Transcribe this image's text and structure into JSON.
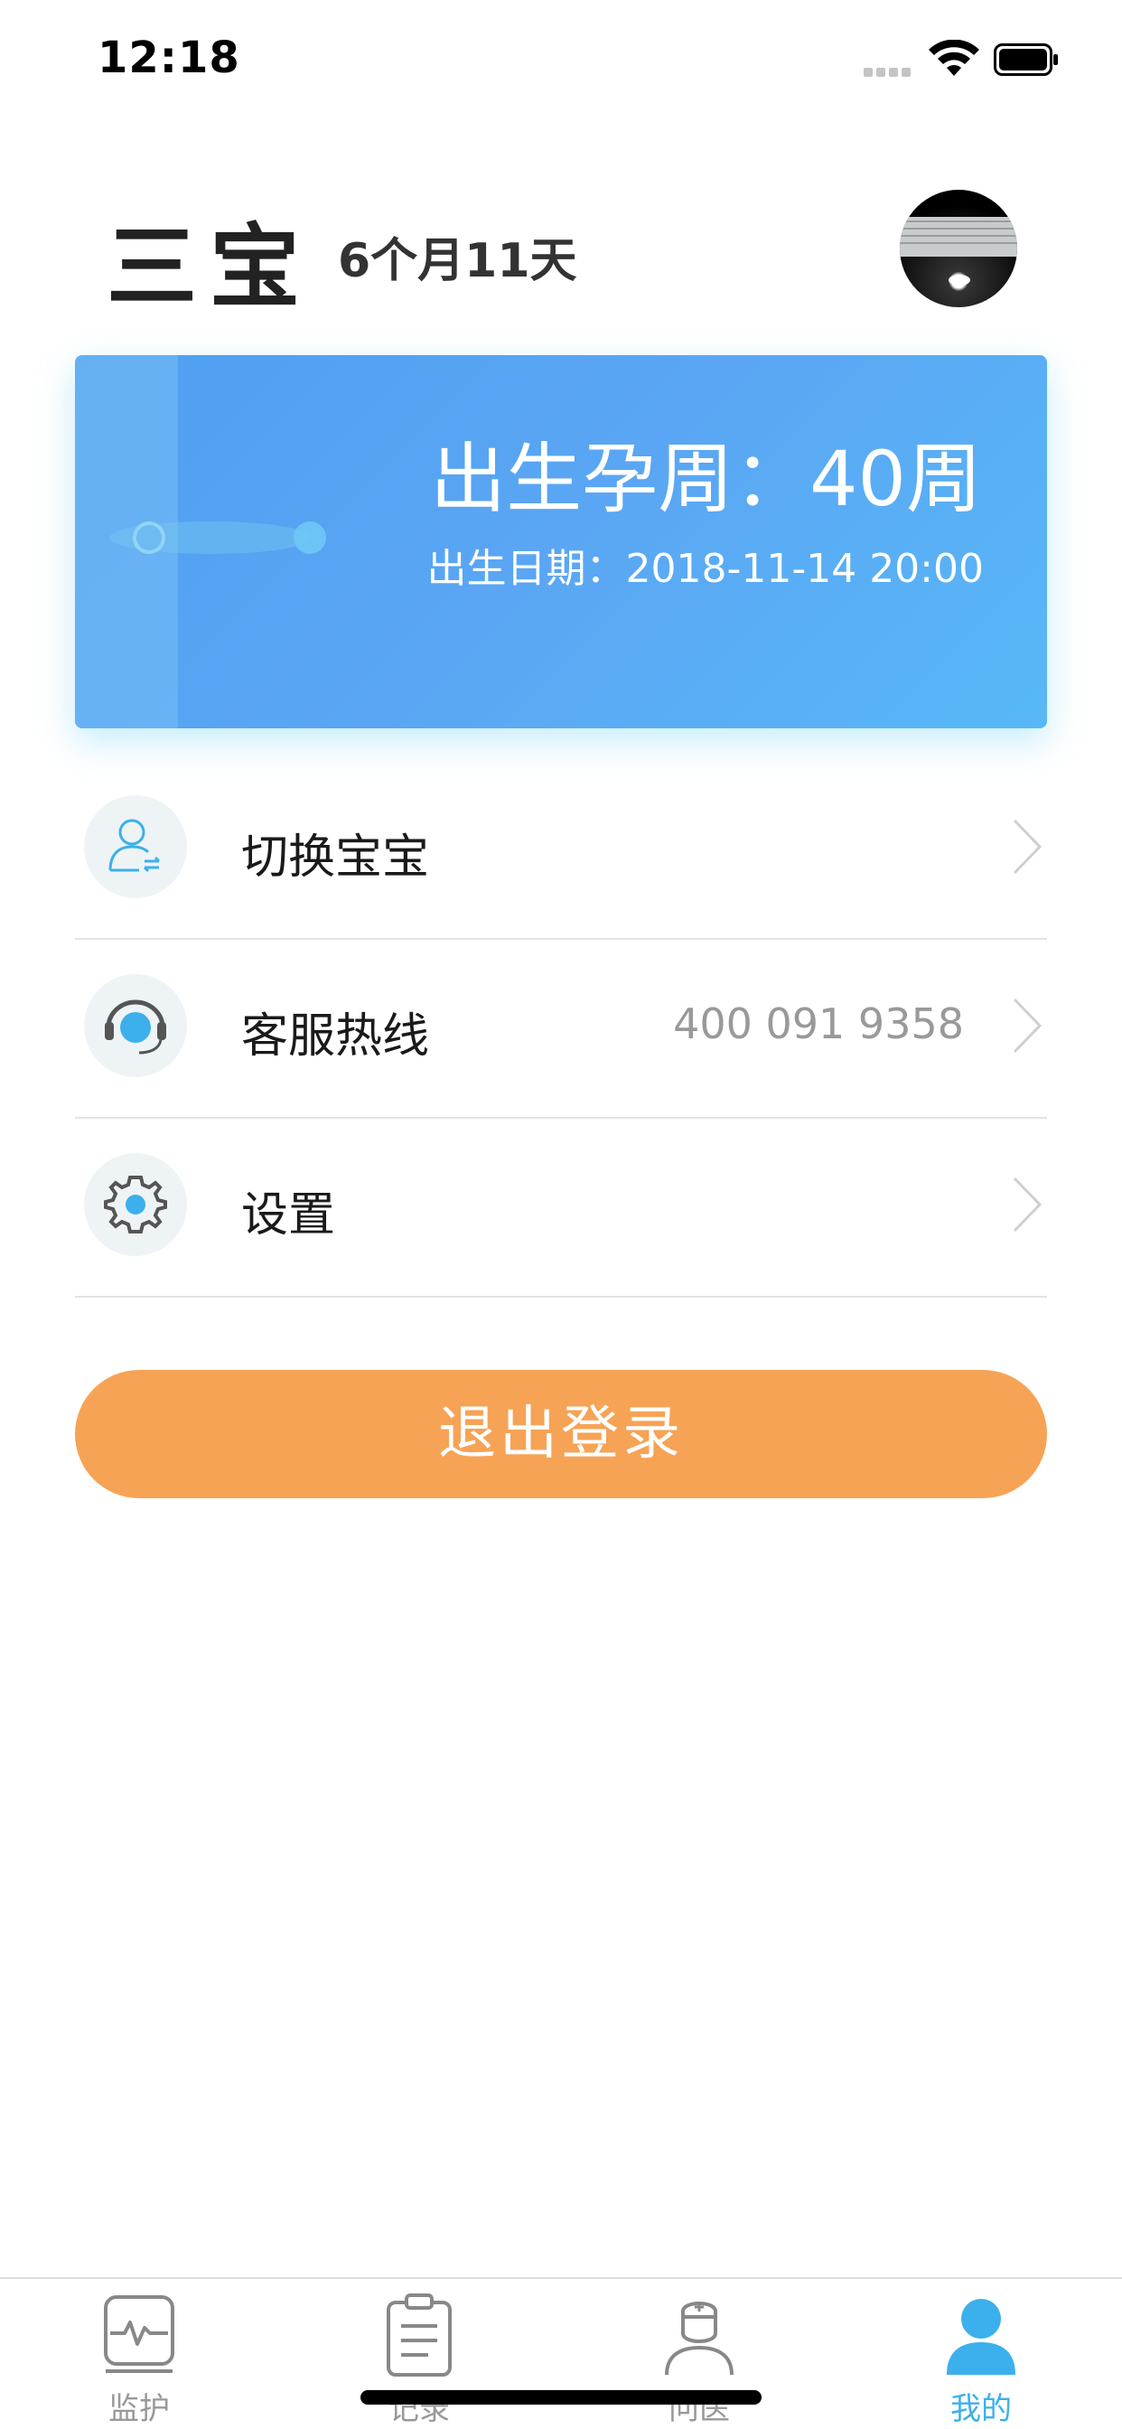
{
  "status_bar": {
    "time": "12:18"
  },
  "header": {
    "baby_name": "三宝",
    "baby_age": "6个月11天",
    "avatar_icon": "profile-photo"
  },
  "birth_card": {
    "gestation": "出生孕周：40周",
    "birth_date": "出生日期：2018-11-14 20:00",
    "colors": {
      "gradient_start": "#4f9ff0",
      "gradient_end": "#58b8f6"
    }
  },
  "menu": {
    "items": [
      {
        "label": "切换宝宝",
        "value": "",
        "icon": "switch-user-icon"
      },
      {
        "label": "客服热线",
        "value": "400 091 9358",
        "icon": "headset-icon"
      },
      {
        "label": "设置",
        "value": "",
        "icon": "gear-icon"
      }
    ]
  },
  "logout": {
    "label": "退出登录",
    "color": "#f6a356"
  },
  "tab_bar": {
    "active_color": "#3cb0ec",
    "tabs": [
      {
        "label": "监护",
        "icon": "heartbeat-monitor-icon",
        "active": false
      },
      {
        "label": "记录",
        "icon": "clipboard-icon",
        "active": false
      },
      {
        "label": "问医",
        "icon": "nurse-icon",
        "active": false
      },
      {
        "label": "我的",
        "icon": "user-icon",
        "active": true
      }
    ]
  }
}
